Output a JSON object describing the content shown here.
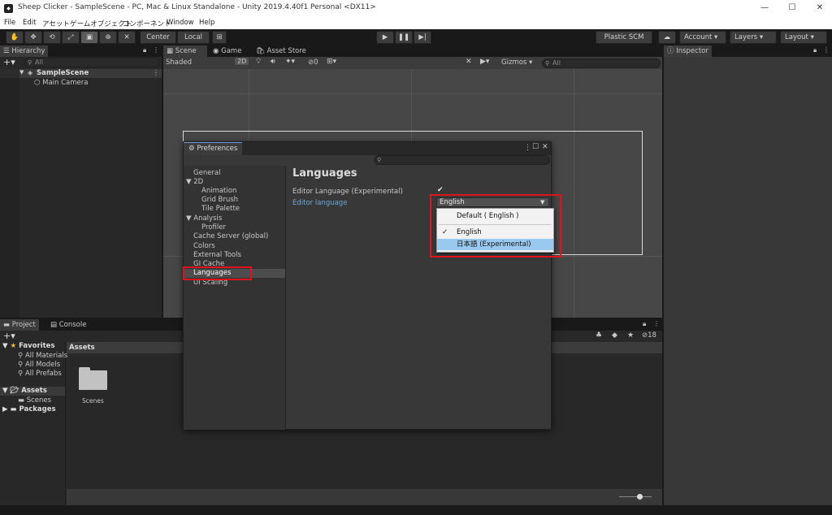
{
  "window": {
    "title": "Sheep Clicker - SampleScene - PC, Mac & Linux Standalone - Unity 2019.4.40f1 Personal <DX11>",
    "minimize": "—",
    "maximize": "☐",
    "close": "✕"
  },
  "menu": [
    "File",
    "Edit",
    "アセット",
    "ゲームオブジェクト",
    "コンポーネント",
    "Window",
    "Help"
  ],
  "toolbar": {
    "pivot": "Center",
    "space": "Local",
    "plastic": "Plastic SCM",
    "account": "Account",
    "layers": "Layers",
    "layout": "Layout"
  },
  "hierarchy": {
    "tab": "Hierarchy",
    "search_placeholder": "All",
    "scene": "SampleScene",
    "items": [
      "Main Camera"
    ]
  },
  "scene": {
    "tabs": [
      "Scene",
      "Game",
      "Asset Store"
    ],
    "shading": "Shaded",
    "mode2d": "2D",
    "hidden_count": "0",
    "gizmos": "Gizmos",
    "search_placeholder": "All"
  },
  "inspector": {
    "tab": "Inspector"
  },
  "project": {
    "tabs": [
      "Project",
      "Console"
    ],
    "favorites_label": "Favorites",
    "favorites": [
      "All Materials",
      "All Models",
      "All Prefabs"
    ],
    "assets_label": "Assets",
    "assets_children": [
      "Scenes"
    ],
    "packages_label": "Packages",
    "assets_header": "Assets",
    "folder": "Scenes",
    "hidden_count": "18"
  },
  "preferences": {
    "tab": "Preferences",
    "sidebar": [
      "General",
      "2D",
      "Animation",
      "Grid Brush",
      "Tile Palette",
      "Analysis",
      "Profiler",
      "Cache Server (global)",
      "Colors",
      "External Tools",
      "GI Cache",
      "Languages",
      "UI Scaling"
    ],
    "heading": "Languages",
    "field1": "Editor Language (Experimental)",
    "field2": "Editor language",
    "dropdown_value": "English",
    "options": [
      "Default ( English )",
      "English",
      "日本語 (Experimental)"
    ]
  },
  "colors": {
    "highlight": "#e0121b",
    "selection": "#99c9ef",
    "link": "#6fa8dc"
  }
}
